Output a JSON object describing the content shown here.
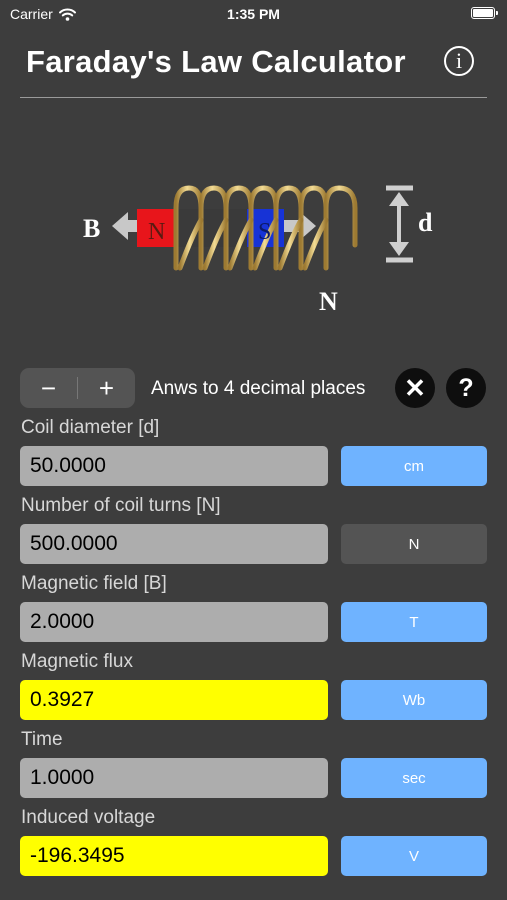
{
  "status_bar": {
    "carrier": "Carrier",
    "time": "1:35 PM"
  },
  "header": {
    "title": "Faraday's Law Calculator"
  },
  "diagram": {
    "label_b": "B",
    "label_n_pole": "N",
    "label_s_pole": "S",
    "label_d": "d",
    "label_turns": "N"
  },
  "controls": {
    "minus": "−",
    "plus": "+",
    "decimals_text": "Anws to 4 decimal places",
    "clear_symbol": "✕",
    "help_symbol": "?"
  },
  "fields": [
    {
      "label": "Coil diameter [d]",
      "value": "50.0000",
      "unit": "cm",
      "unit_enabled": true,
      "result": false
    },
    {
      "label": "Number of coil turns [N]",
      "value": "500.0000",
      "unit": "N",
      "unit_enabled": false,
      "result": false
    },
    {
      "label": "Magnetic field [B]",
      "value": "2.0000",
      "unit": "T",
      "unit_enabled": true,
      "result": false
    },
    {
      "label": "Magnetic flux",
      "value": "0.3927",
      "unit": "Wb",
      "unit_enabled": true,
      "result": true
    },
    {
      "label": "Time",
      "value": "1.0000",
      "unit": "sec",
      "unit_enabled": true,
      "result": false
    },
    {
      "label": "Induced voltage",
      "value": "-196.3495",
      "unit": "V",
      "unit_enabled": true,
      "result": true
    }
  ],
  "colors": {
    "background": "#3d3d3d",
    "input": "#adadad",
    "result": "#ffff00",
    "unit_button": "#6fb3ff",
    "unit_button_disabled": "#545454",
    "coil": "#e7c56e",
    "magnet_north": "#e8151b",
    "magnet_south": "#1733d6"
  }
}
